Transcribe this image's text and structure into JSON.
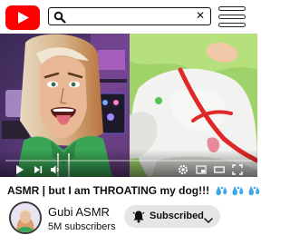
{
  "header": {
    "logo_icon": "youtube-logo-icon",
    "search": {
      "value": "",
      "placeholder": "",
      "search_icon": "search-icon",
      "clear_icon": "close-icon",
      "clear_glyph": "✕"
    },
    "menu_icon": "hamburger-menu-icon"
  },
  "player": {
    "progress": 0.0,
    "controls": [
      "play-icon",
      "next-icon",
      "volume-icon",
      "settings-icon",
      "miniplayer-icon",
      "theater-icon",
      "fullscreen-icon"
    ]
  },
  "video": {
    "title": "ASMR | but I am THROATING my dog!!!",
    "title_emoji_icon": "sweat-droplets-icon"
  },
  "channel": {
    "name": "Gubi ASMR",
    "subscribers": "5M subscribers",
    "avatar_icon": "channel-avatar",
    "subscribe": {
      "label": "Subscribed",
      "bell_icon": "bell-icon",
      "chevron_icon": "chevron-down-icon"
    }
  },
  "colors": {
    "brand_red": "#ff0000",
    "button_bg": "#e5e5e5",
    "text": "#0f0f0f"
  }
}
